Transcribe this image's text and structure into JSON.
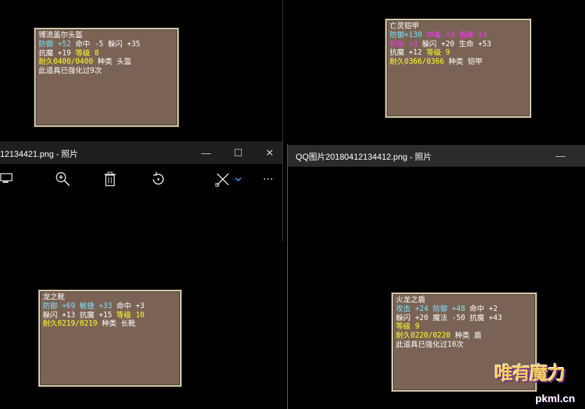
{
  "tooltips": {
    "t1": {
      "name": "博流盖尔头盔",
      "l1": [
        "防御",
        "+52",
        "命中",
        "-5",
        "躲闪",
        "+35"
      ],
      "l2": [
        "抗魔",
        "+19",
        "等级",
        "8"
      ],
      "l3": [
        "耐久0400/0400",
        "种类",
        "头盔"
      ],
      "l4": "此道具已强化过9次"
    },
    "t2": {
      "name": "亡灵铠甲",
      "l1": [
        "防御+130",
        "中毒",
        "+3",
        "昏睡",
        "+3"
      ],
      "l2": [
        "石化",
        "+3",
        "躲闪",
        "+20",
        "生命",
        "+53"
      ],
      "l3": [
        "抗魔",
        "+12",
        "等级",
        "9"
      ],
      "l4": [
        "耐久0366/0366",
        "种类",
        "铠甲"
      ]
    },
    "t3": {
      "name": "龙之靴",
      "l1": [
        "防御",
        "+69",
        "敏捷",
        "+33",
        "命中",
        "+3"
      ],
      "l2": [
        "躲闪",
        "+13",
        "抗魔",
        "+15",
        "等级",
        "10"
      ],
      "l3": [
        "耐久0219/0219",
        "种类",
        "长靴"
      ]
    },
    "t4": {
      "name": "火龙之盾",
      "l1": [
        "攻击",
        "+24",
        "防御",
        "+48",
        "命中",
        "+2"
      ],
      "l2": [
        "躲闪",
        "+20",
        "魔法",
        "-50",
        "抗魔",
        "+43"
      ],
      "l3": [
        "等级",
        "9"
      ],
      "l4": [
        "耐久0220/0220",
        "种类",
        "盾"
      ],
      "l5": "此道具已强化过10次"
    }
  },
  "window_left": {
    "title": "12134421.png - 照片",
    "min": "—",
    "max": "☐",
    "close": "✕",
    "more": "···"
  },
  "window_right": {
    "title": "QQ图片20180412134412.png - 照片",
    "min": "—"
  },
  "watermark": {
    "brand": "唯有魔力",
    "url": "pkml.cn"
  }
}
